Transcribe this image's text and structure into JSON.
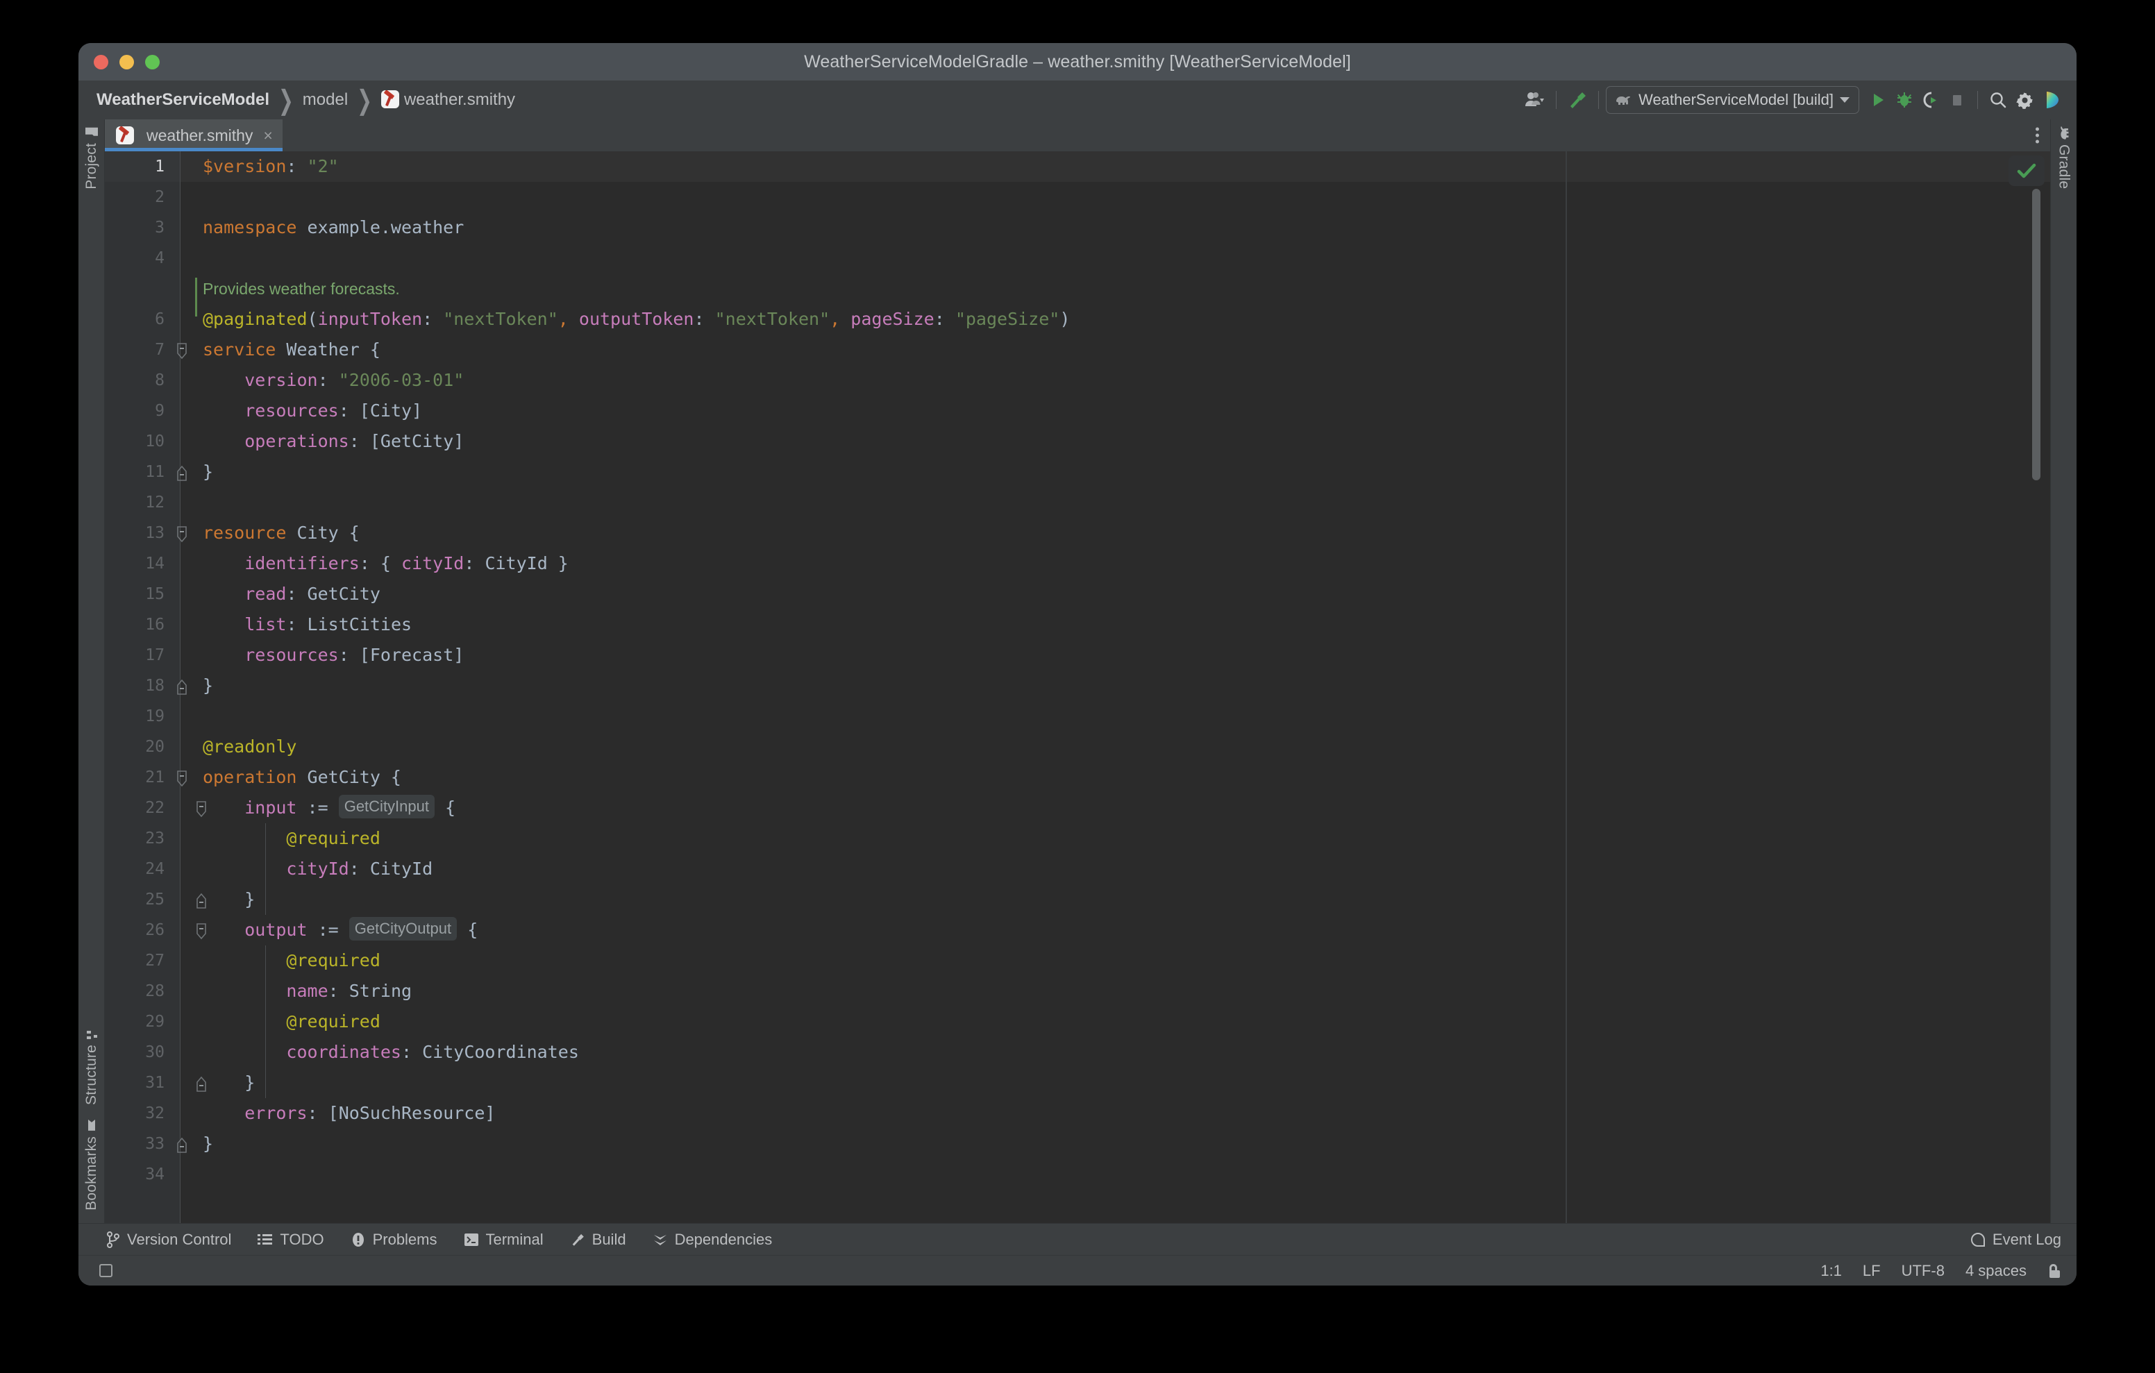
{
  "window": {
    "title": "WeatherServiceModelGradle – weather.smithy [WeatherServiceModel]",
    "traffic": {
      "close": "close-window",
      "minimize": "minimize-window",
      "zoom": "zoom-window"
    }
  },
  "breadcrumb": {
    "project": "WeatherServiceModel",
    "folder": "model",
    "file": "weather.smithy",
    "separator": "❯"
  },
  "toolbar": {
    "account_label": "account-icon",
    "build_label": "build-hammer-icon",
    "run_config": "WeatherServiceModel [build]",
    "run_label": "run-icon",
    "debug_label": "debug-icon",
    "coverage_label": "run-with-coverage-icon",
    "stop_label": "stop-icon",
    "search_label": "search-icon",
    "settings_label": "settings-icon",
    "ai_label": "ai-assistant-icon"
  },
  "tool_windows": {
    "left_top": [
      {
        "label": "Project",
        "icon": "project-folder-icon"
      }
    ],
    "left_bottom": [
      {
        "label": "Structure",
        "icon": "structure-icon"
      },
      {
        "label": "Bookmarks",
        "icon": "bookmarks-icon"
      }
    ],
    "right_top": [
      {
        "label": "Gradle",
        "icon": "gradle-elephant-icon"
      }
    ]
  },
  "tab": {
    "title": "weather.smithy",
    "close": "×",
    "icon": "smithy-file-icon"
  },
  "editor": {
    "inspection_status": "checkmark-ok",
    "lines": [
      {
        "n": "1",
        "active": true,
        "parts": [
          {
            "t": "$version",
            "c": "k-kw"
          },
          {
            "t": ": ",
            "c": "k-punc"
          },
          {
            "t": "\"2\"",
            "c": "k-str"
          }
        ]
      },
      {
        "n": "2",
        "parts": []
      },
      {
        "n": "3",
        "parts": [
          {
            "t": "namespace",
            "c": "k-kw"
          },
          {
            "t": " example.weather",
            "c": "k-id"
          }
        ]
      },
      {
        "n": "4",
        "parts": []
      },
      {
        "n": "",
        "doc": "Provides weather forecasts."
      },
      {
        "n": "6",
        "parts": [
          {
            "t": "@paginated",
            "c": "k-ann"
          },
          {
            "t": "(",
            "c": "k-punc"
          },
          {
            "t": "inputToken",
            "c": "k-key"
          },
          {
            "t": ": ",
            "c": "k-punc"
          },
          {
            "t": "\"nextToken\"",
            "c": "k-str"
          },
          {
            "t": ",",
            "c": "k-comma"
          },
          {
            "t": " ",
            "c": "k-punc"
          },
          {
            "t": "outputToken",
            "c": "k-key"
          },
          {
            "t": ": ",
            "c": "k-punc"
          },
          {
            "t": "\"nextToken\"",
            "c": "k-str"
          },
          {
            "t": ",",
            "c": "k-comma"
          },
          {
            "t": " ",
            "c": "k-punc"
          },
          {
            "t": "pageSize",
            "c": "k-key"
          },
          {
            "t": ": ",
            "c": "k-punc"
          },
          {
            "t": "\"pageSize\"",
            "c": "k-str"
          },
          {
            "t": ")",
            "c": "k-punc"
          }
        ]
      },
      {
        "n": "7",
        "fold": "open",
        "parts": [
          {
            "t": "service",
            "c": "k-kw"
          },
          {
            "t": " Weather {",
            "c": "k-id"
          }
        ]
      },
      {
        "n": "8",
        "parts": [
          {
            "t": "    ",
            "c": "k-punc"
          },
          {
            "t": "version",
            "c": "k-key"
          },
          {
            "t": ": ",
            "c": "k-punc"
          },
          {
            "t": "\"2006-03-01\"",
            "c": "k-str"
          }
        ]
      },
      {
        "n": "9",
        "parts": [
          {
            "t": "    ",
            "c": "k-punc"
          },
          {
            "t": "resources",
            "c": "k-key"
          },
          {
            "t": ": ",
            "c": "k-punc"
          },
          {
            "t": "[City]",
            "c": "k-id"
          }
        ]
      },
      {
        "n": "10",
        "parts": [
          {
            "t": "    ",
            "c": "k-punc"
          },
          {
            "t": "operations",
            "c": "k-key"
          },
          {
            "t": ": ",
            "c": "k-punc"
          },
          {
            "t": "[GetCity]",
            "c": "k-id"
          }
        ]
      },
      {
        "n": "11",
        "fold": "close",
        "parts": [
          {
            "t": "}",
            "c": "k-id"
          }
        ]
      },
      {
        "n": "12",
        "parts": []
      },
      {
        "n": "13",
        "fold": "open",
        "parts": [
          {
            "t": "resource",
            "c": "k-kw"
          },
          {
            "t": " City {",
            "c": "k-id"
          }
        ]
      },
      {
        "n": "14",
        "parts": [
          {
            "t": "    ",
            "c": "k-punc"
          },
          {
            "t": "identifiers",
            "c": "k-key"
          },
          {
            "t": ": ",
            "c": "k-punc"
          },
          {
            "t": "{ ",
            "c": "k-id"
          },
          {
            "t": "cityId",
            "c": "k-key"
          },
          {
            "t": ": ",
            "c": "k-punc"
          },
          {
            "t": "CityId }",
            "c": "k-id"
          }
        ]
      },
      {
        "n": "15",
        "parts": [
          {
            "t": "    ",
            "c": "k-punc"
          },
          {
            "t": "read",
            "c": "k-key"
          },
          {
            "t": ": ",
            "c": "k-punc"
          },
          {
            "t": "GetCity",
            "c": "k-id"
          }
        ]
      },
      {
        "n": "16",
        "parts": [
          {
            "t": "    ",
            "c": "k-punc"
          },
          {
            "t": "list",
            "c": "k-key"
          },
          {
            "t": ": ",
            "c": "k-punc"
          },
          {
            "t": "ListCities",
            "c": "k-id"
          }
        ]
      },
      {
        "n": "17",
        "parts": [
          {
            "t": "    ",
            "c": "k-punc"
          },
          {
            "t": "resources",
            "c": "k-key"
          },
          {
            "t": ": ",
            "c": "k-punc"
          },
          {
            "t": "[Forecast]",
            "c": "k-id"
          }
        ]
      },
      {
        "n": "18",
        "fold": "close",
        "parts": [
          {
            "t": "}",
            "c": "k-id"
          }
        ]
      },
      {
        "n": "19",
        "parts": []
      },
      {
        "n": "20",
        "parts": [
          {
            "t": "@readonly",
            "c": "k-ann"
          }
        ]
      },
      {
        "n": "21",
        "fold": "open",
        "parts": [
          {
            "t": "operation",
            "c": "k-kw"
          },
          {
            "t": " GetCity {",
            "c": "k-id"
          }
        ]
      },
      {
        "n": "22",
        "fold": "open2",
        "parts": [
          {
            "t": "    ",
            "c": "k-punc"
          },
          {
            "t": "input",
            "c": "k-key"
          },
          {
            "t": " := ",
            "c": "k-id"
          },
          {
            "t": "GetCityInput",
            "c": "inlay"
          },
          {
            "t": " {",
            "c": "k-id"
          }
        ]
      },
      {
        "n": "23",
        "parts": [
          {
            "t": "        ",
            "c": "k-punc"
          },
          {
            "t": "@required",
            "c": "k-ann"
          }
        ]
      },
      {
        "n": "24",
        "parts": [
          {
            "t": "        ",
            "c": "k-punc"
          },
          {
            "t": "cityId",
            "c": "k-key"
          },
          {
            "t": ": ",
            "c": "k-punc"
          },
          {
            "t": "CityId",
            "c": "k-id"
          }
        ]
      },
      {
        "n": "25",
        "fold": "close2",
        "parts": [
          {
            "t": "    }",
            "c": "k-id"
          }
        ]
      },
      {
        "n": "26",
        "fold": "open2",
        "parts": [
          {
            "t": "    ",
            "c": "k-punc"
          },
          {
            "t": "output",
            "c": "k-key"
          },
          {
            "t": " := ",
            "c": "k-id"
          },
          {
            "t": "GetCityOutput",
            "c": "inlay"
          },
          {
            "t": " {",
            "c": "k-id"
          }
        ]
      },
      {
        "n": "27",
        "parts": [
          {
            "t": "        ",
            "c": "k-punc"
          },
          {
            "t": "@required",
            "c": "k-ann"
          }
        ]
      },
      {
        "n": "28",
        "parts": [
          {
            "t": "        ",
            "c": "k-punc"
          },
          {
            "t": "name",
            "c": "k-key"
          },
          {
            "t": ": ",
            "c": "k-punc"
          },
          {
            "t": "String",
            "c": "k-id"
          }
        ]
      },
      {
        "n": "29",
        "parts": [
          {
            "t": "        ",
            "c": "k-punc"
          },
          {
            "t": "@required",
            "c": "k-ann"
          }
        ]
      },
      {
        "n": "30",
        "parts": [
          {
            "t": "        ",
            "c": "k-punc"
          },
          {
            "t": "coordinates",
            "c": "k-key"
          },
          {
            "t": ": ",
            "c": "k-punc"
          },
          {
            "t": "CityCoordinates",
            "c": "k-id"
          }
        ]
      },
      {
        "n": "31",
        "fold": "close2",
        "parts": [
          {
            "t": "    }",
            "c": "k-id"
          }
        ]
      },
      {
        "n": "32",
        "parts": [
          {
            "t": "    ",
            "c": "k-punc"
          },
          {
            "t": "errors",
            "c": "k-key"
          },
          {
            "t": ": ",
            "c": "k-punc"
          },
          {
            "t": "[NoSuchResource]",
            "c": "k-id"
          }
        ]
      },
      {
        "n": "33",
        "fold": "close",
        "parts": [
          {
            "t": "}",
            "c": "k-id"
          }
        ]
      },
      {
        "n": "34",
        "parts": []
      }
    ]
  },
  "bottom_tools": [
    {
      "label": "Version Control",
      "icon": "branch-icon"
    },
    {
      "label": "TODO",
      "icon": "list-icon"
    },
    {
      "label": "Problems",
      "icon": "exclamation-icon"
    },
    {
      "label": "Terminal",
      "icon": "terminal-icon"
    },
    {
      "label": "Build",
      "icon": "hammer-icon"
    },
    {
      "label": "Dependencies",
      "icon": "chevrons-down-icon"
    }
  ],
  "event_log": {
    "label": "Event Log",
    "icon": "balloon-icon"
  },
  "status": {
    "caret": "1:1",
    "line_separator": "LF",
    "encoding": "UTF-8",
    "indent": "4 spaces",
    "lock": "unlocked-icon"
  },
  "colors": {
    "window_chrome": "#3c3f41",
    "titlebar": "#4b5055",
    "editor_bg": "#2b2b2b",
    "gutter_bg": "#313335",
    "tab_active": "#4e5254",
    "tab_underline": "#4a88c7",
    "keyword": "#cc7832",
    "string": "#6a8759",
    "annotation": "#bbb529",
    "member_key": "#c77dbb",
    "identifier": "#a9b7c6",
    "doc_comment": "#629755",
    "ok_green": "#499c54"
  }
}
